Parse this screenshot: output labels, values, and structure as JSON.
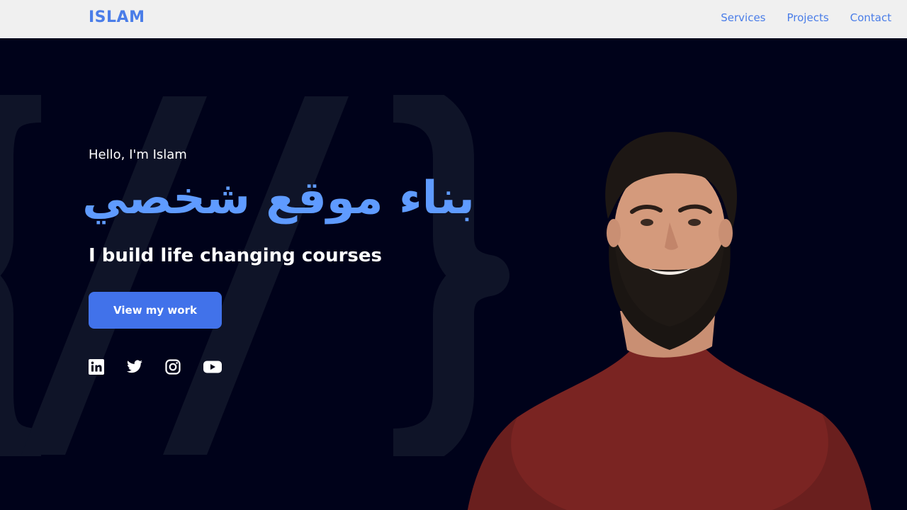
{
  "nav": {
    "logo": "ISLAM",
    "links": [
      "Services",
      "Projects",
      "Contact"
    ]
  },
  "hero": {
    "greeting": "Hello, I'm Islam",
    "arabic_title": "بناء موقع شخصي",
    "tagline": "I build life changing courses",
    "cta_label": "View my work"
  },
  "socials": [
    "linkedin-icon",
    "twitter-icon",
    "instagram-icon",
    "youtube-icon"
  ],
  "colors": {
    "accent": "#4172ea",
    "title_blue": "#5f9bff",
    "nav_text": "#4a7de8",
    "background": "#00021a",
    "navbar_bg": "#f0f0f0"
  }
}
